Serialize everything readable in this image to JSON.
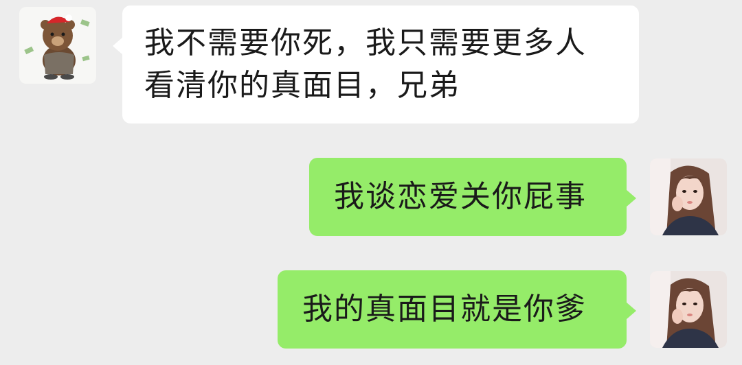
{
  "messages": [
    {
      "sender": "bear",
      "direction": "incoming",
      "avatar_icon": "brown-bear-sticker-avatar",
      "text": "我不需要你死，我只需要更多人\n看清你的真面目，兄弟"
    },
    {
      "sender": "girl",
      "direction": "outgoing",
      "avatar_icon": "girl-portrait-avatar",
      "text": "我谈恋爱关你屁事"
    },
    {
      "sender": "girl",
      "direction": "outgoing",
      "avatar_icon": "girl-portrait-avatar",
      "text": "我的真面目就是你爹"
    }
  ],
  "colors": {
    "background": "#ededed",
    "incoming_bubble": "#ffffff",
    "outgoing_bubble": "#95ec69",
    "text": "#1a1a1a"
  }
}
